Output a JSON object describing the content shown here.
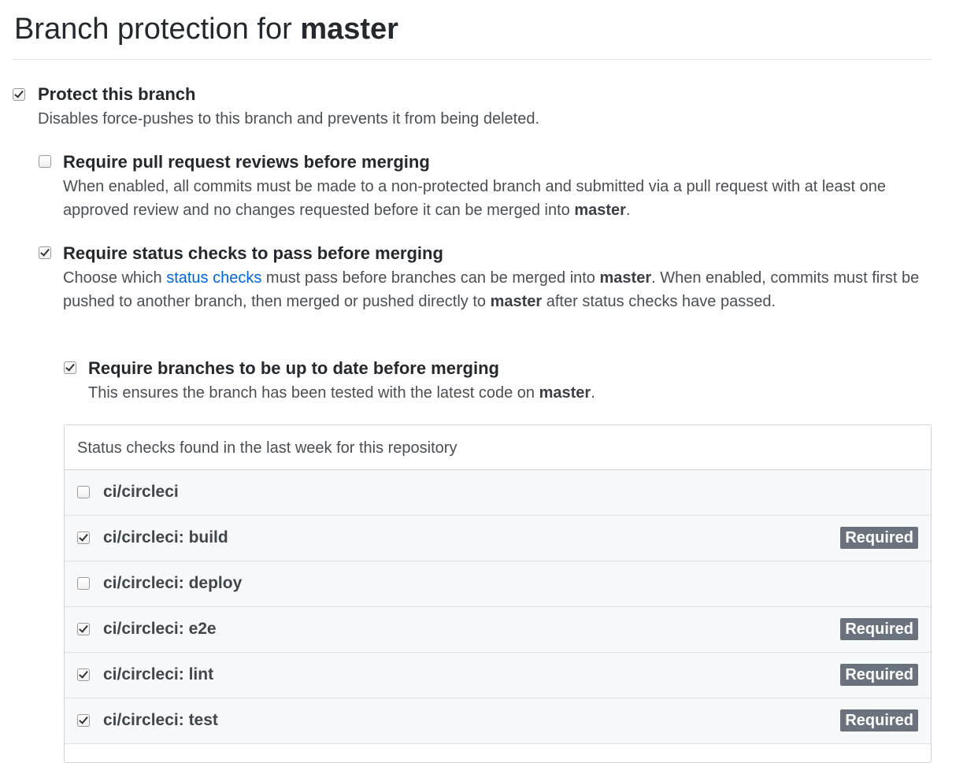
{
  "page": {
    "title_prefix": "Branch protection for ",
    "branch": "master"
  },
  "protect": {
    "checked": true,
    "label": "Protect this branch",
    "desc": "Disables force-pushes to this branch and prevents it from being deleted."
  },
  "reviews": {
    "checked": false,
    "label": "Require pull request reviews before merging",
    "desc_1": "When enabled, all commits must be made to a non-protected branch and submitted via a pull request with at least one approved review and no changes requested before it can be merged into ",
    "desc_branch": "master",
    "desc_2": "."
  },
  "status_checks": {
    "checked": true,
    "label": "Require status checks to pass before merging",
    "desc_1": "Choose which ",
    "link_text": "status checks",
    "desc_2": " must pass before branches can be merged into ",
    "desc_branch_a": "master",
    "desc_3": ". When enabled, commits must first be pushed to another branch, then merged or pushed directly to ",
    "desc_branch_b": "master",
    "desc_4": " after status checks have passed."
  },
  "up_to_date": {
    "checked": true,
    "label": "Require branches to be up to date before merging",
    "desc_1": "This ensures the branch has been tested with the latest code on ",
    "desc_branch": "master",
    "desc_2": "."
  },
  "checks_box": {
    "header": "Status checks found in the last week for this repository",
    "badge_label": "Required",
    "items": [
      {
        "name": "ci/circleci",
        "checked": false,
        "required": false
      },
      {
        "name": "ci/circleci: build",
        "checked": true,
        "required": true
      },
      {
        "name": "ci/circleci: deploy",
        "checked": false,
        "required": false
      },
      {
        "name": "ci/circleci: e2e",
        "checked": true,
        "required": true
      },
      {
        "name": "ci/circleci: lint",
        "checked": true,
        "required": true
      },
      {
        "name": "ci/circleci: test",
        "checked": true,
        "required": true
      }
    ]
  }
}
